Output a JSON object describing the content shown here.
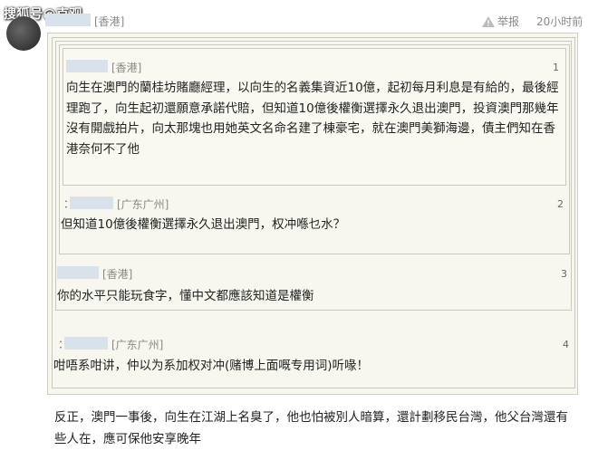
{
  "watermark": "搜狐号@克观",
  "header": {
    "location": "[香港]",
    "report_label": "举报",
    "time": "20小时前"
  },
  "thread": {
    "floors": [
      {
        "location": "[香港]",
        "number": "1",
        "text": "向生在澳門的蘭桂坊賭廳經理，以向生的名義集資近10億，起初每月利息是有給的，最後經理跑了，向生起初還願意承諾代賠，但知道10億後權衡選擇永久退出澳門，投資澳門那幾年沒有開戲拍片，向太那塊也用她英文名命名建了棟豪宅，就在澳門美獅海邊，債主們知在香港奈何不了他"
      },
      {
        "location": "[广东广州]",
        "number": "2",
        "text": "但知道10億後權衡選擇永久退出澳門，权冲喺乜水？"
      },
      {
        "location": "[香港]",
        "number": "3",
        "text": "你的水平只能玩食字，懂中文都應該知道是權衡"
      },
      {
        "location": "[广东广州]",
        "number": "4",
        "text": "咁唔系咁讲，仲以为系加权对冲(赌博上面嘅专用词)听喙！"
      }
    ]
  },
  "main_text": "反正，澳門一事後，向生在江湖上名臭了，他也怕被別人暗算，還計劃移民台灣，他父台灣還有些人在，應可保他安享晚年"
}
